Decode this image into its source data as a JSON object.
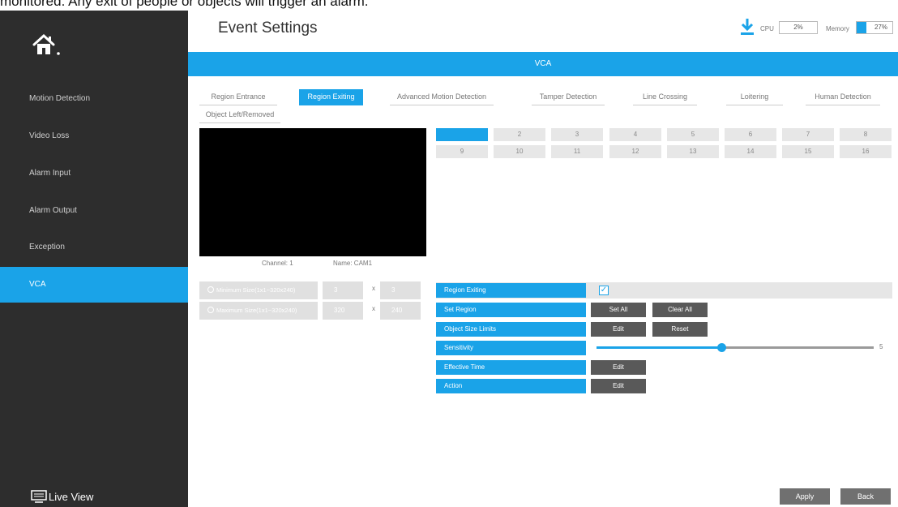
{
  "caption": "monitored. Any exit of people or objects will trigger an alarm.",
  "header": {
    "title": "Event Settings"
  },
  "system": {
    "cpu_label": "CPU",
    "cpu_value": "2%",
    "memory_label": "Memory",
    "memory_value": "27%",
    "memory_fraction": 0.27
  },
  "sidebar": {
    "items": [
      {
        "label": "Motion Detection"
      },
      {
        "label": "Video Loss"
      },
      {
        "label": "Alarm Input"
      },
      {
        "label": "Alarm Output"
      },
      {
        "label": "Exception"
      },
      {
        "label": "VCA",
        "active": true
      }
    ],
    "live_view": "Live View"
  },
  "section_title": "VCA",
  "tabs": [
    {
      "label": "Region Entrance"
    },
    {
      "label": "Region Exiting",
      "active": true
    },
    {
      "label": "Advanced Motion Detection"
    },
    {
      "label": "Tamper Detection"
    },
    {
      "label": "Line Crossing"
    },
    {
      "label": "Loitering"
    },
    {
      "label": "Human Detection"
    },
    {
      "label": "Object Left/Removed"
    }
  ],
  "video": {
    "channel": "Channel: 1",
    "name": "Name: CAM1"
  },
  "channels": [
    "1",
    "2",
    "3",
    "4",
    "5",
    "6",
    "7",
    "8",
    "9",
    "10",
    "11",
    "12",
    "13",
    "14",
    "15",
    "16"
  ],
  "size_limits": {
    "min": {
      "label": "Minimum Size(1x1~320x240)",
      "w": "3",
      "h": "3"
    },
    "max": {
      "label": "Maximum Size(1x1~320x240)",
      "w": "320",
      "h": "240"
    },
    "x": "x"
  },
  "settings": {
    "region_exiting": "Region Exiting",
    "region_exiting_checked": true,
    "set_region": "Set Region",
    "set_all": "Set All",
    "clear_all": "Clear All",
    "object_size_limits": "Object Size Limits",
    "edit": "Edit",
    "reset": "Reset",
    "sensitivity": "Sensitivity",
    "sensitivity_value": "5",
    "sensitivity_fraction": 0.45,
    "effective_time": "Effective Time",
    "action": "Action"
  },
  "footer": {
    "apply": "Apply",
    "back": "Back"
  },
  "colors": {
    "accent": "#1aa3e8",
    "sidebar": "#2d2d2d",
    "button": "#595959"
  }
}
